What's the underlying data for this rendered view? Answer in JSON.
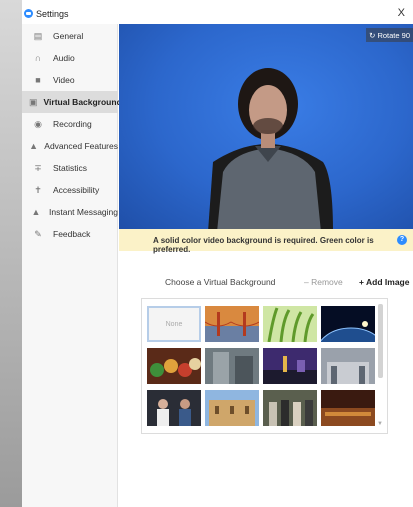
{
  "window": {
    "title": "Settings",
    "close_label": "X"
  },
  "sidebar": {
    "items": [
      {
        "label": "General",
        "icon": "general-icon",
        "active": false
      },
      {
        "label": "Audio",
        "icon": "headphones-icon",
        "active": false
      },
      {
        "label": "Video",
        "icon": "camera-icon",
        "active": false
      },
      {
        "label": "Virtual Background",
        "icon": "background-icon",
        "active": true
      },
      {
        "label": "Recording",
        "icon": "record-icon",
        "active": false
      },
      {
        "label": "Advanced Features",
        "icon": "advanced-icon",
        "active": false
      },
      {
        "label": "Statistics",
        "icon": "statistics-icon",
        "active": false
      },
      {
        "label": "Accessibility",
        "icon": "accessibility-icon",
        "active": false
      },
      {
        "label": "Instant Messaging",
        "icon": "chat-icon",
        "active": false
      },
      {
        "label": "Feedback",
        "icon": "feedback-icon",
        "active": false
      }
    ]
  },
  "preview": {
    "rotate_label": "Rotate 90"
  },
  "notice": {
    "text": "A solid color video background is required. Green color is preferred.",
    "help": "?"
  },
  "chooser": {
    "label": "Choose a Virtual Background",
    "remove_label": "– Remove",
    "add_label": "+ Add Image"
  },
  "backgrounds": [
    {
      "name": "none",
      "label": "None",
      "selected": true
    },
    {
      "name": "golden-gate-bridge"
    },
    {
      "name": "grass"
    },
    {
      "name": "earth-from-space"
    },
    {
      "name": "muppets-crowd"
    },
    {
      "name": "interior-hall"
    },
    {
      "name": "city-night"
    },
    {
      "name": "grand-hall"
    },
    {
      "name": "two-people-on-stage"
    },
    {
      "name": "building-facade"
    },
    {
      "name": "group-of-people"
    },
    {
      "name": "orchestra-stage"
    }
  ],
  "colors": {
    "accent": "#2d8cff",
    "notice_bg": "#fbf2c8",
    "preview_bg": "#2c67cc"
  }
}
